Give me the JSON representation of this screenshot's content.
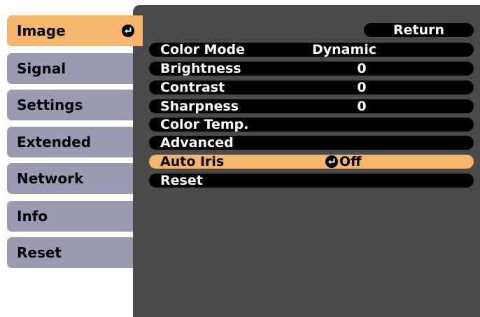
{
  "tabs": [
    {
      "label": "Image",
      "active": true
    },
    {
      "label": "Signal"
    },
    {
      "label": "Settings"
    },
    {
      "label": "Extended"
    },
    {
      "label": "Network"
    },
    {
      "label": "Info"
    },
    {
      "label": "Reset"
    }
  ],
  "return_label": "Return",
  "rows": [
    {
      "label": "Color Mode",
      "value": "Dynamic"
    },
    {
      "label": "Brightness",
      "value": "0"
    },
    {
      "label": "Contrast",
      "value": "0"
    },
    {
      "label": "Sharpness",
      "value": "0"
    },
    {
      "label": "Color Temp.",
      "value": ""
    },
    {
      "label": "Advanced",
      "value": ""
    },
    {
      "label": "Auto Iris",
      "value": "Off",
      "selected": true
    },
    {
      "label": "Reset",
      "value": ""
    }
  ],
  "icons": {
    "enter": "enter-icon"
  },
  "colors": {
    "active": "#f5b56a",
    "tab": "#9a9ab3",
    "panel": "#4a4a4a",
    "pill": "#000000"
  }
}
